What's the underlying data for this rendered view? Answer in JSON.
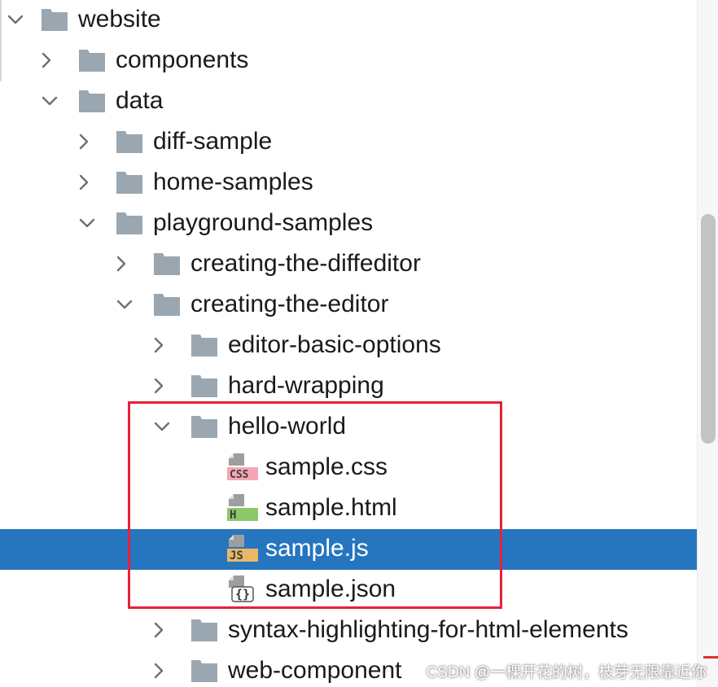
{
  "tree": [
    {
      "name": "website",
      "kind": "folder",
      "state": "expanded",
      "depth": 0
    },
    {
      "name": "components",
      "kind": "folder",
      "state": "collapsed",
      "depth": 1
    },
    {
      "name": "data",
      "kind": "folder",
      "state": "expanded",
      "depth": 1
    },
    {
      "name": "diff-sample",
      "kind": "folder",
      "state": "collapsed",
      "depth": 2
    },
    {
      "name": "home-samples",
      "kind": "folder",
      "state": "collapsed",
      "depth": 2
    },
    {
      "name": "playground-samples",
      "kind": "folder",
      "state": "expanded",
      "depth": 2
    },
    {
      "name": "creating-the-diffeditor",
      "kind": "folder",
      "state": "collapsed",
      "depth": 3
    },
    {
      "name": "creating-the-editor",
      "kind": "folder",
      "state": "expanded",
      "depth": 3
    },
    {
      "name": "editor-basic-options",
      "kind": "folder",
      "state": "collapsed",
      "depth": 4
    },
    {
      "name": "hard-wrapping",
      "kind": "folder",
      "state": "collapsed",
      "depth": 4
    },
    {
      "name": "hello-world",
      "kind": "folder",
      "state": "expanded",
      "depth": 4
    },
    {
      "name": "sample.css",
      "kind": "file",
      "filetype": "css",
      "badge": "CSS",
      "depth": 5
    },
    {
      "name": "sample.html",
      "kind": "file",
      "filetype": "html",
      "badge": "H",
      "depth": 5
    },
    {
      "name": "sample.js",
      "kind": "file",
      "filetype": "js",
      "badge": "JS",
      "depth": 5,
      "selected": true
    },
    {
      "name": "sample.json",
      "kind": "file",
      "filetype": "json",
      "badge": "{}",
      "depth": 5
    },
    {
      "name": "syntax-highlighting-for-html-elements",
      "kind": "folder",
      "state": "collapsed",
      "depth": 4
    },
    {
      "name": "web-component",
      "kind": "folder",
      "state": "collapsed",
      "depth": 4
    }
  ],
  "watermark": "CSDN @一棵开花的树，枝芽无限靠近你",
  "colors": {
    "selection": "#2675bf",
    "folder": "#9aa7b0",
    "highlight_box": "#e8203a",
    "badge_css": "#f3a7b4",
    "badge_html": "#8dc86a",
    "badge_js": "#e7b865",
    "text": "#1a1a1a"
  }
}
